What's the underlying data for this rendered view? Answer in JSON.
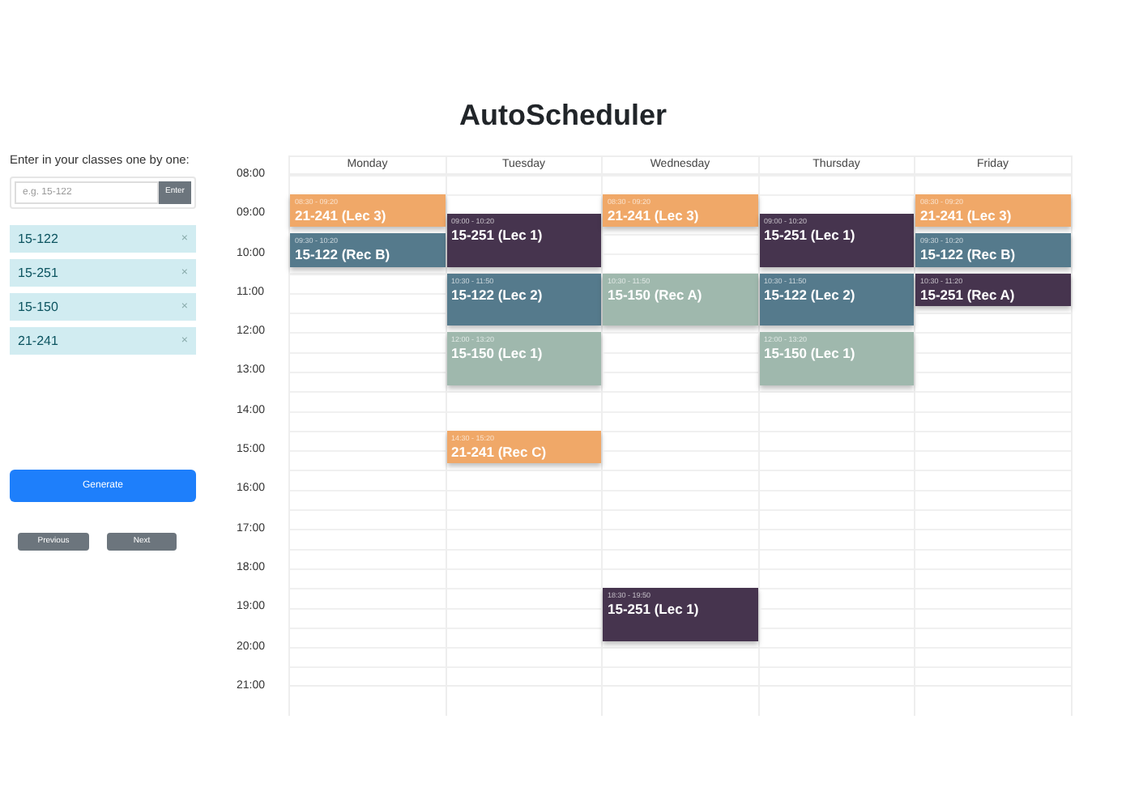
{
  "title": "AutoScheduler",
  "input_panel": {
    "label": "Enter in your classes one by one:",
    "placeholder": "e.g. 15-122",
    "enter_button": "Enter",
    "classes": [
      {
        "name": "15-122",
        "remove": "×"
      },
      {
        "name": "15-251",
        "remove": "×"
      },
      {
        "name": "15-150",
        "remove": "×"
      },
      {
        "name": "21-241",
        "remove": "×"
      }
    ],
    "generate_button": "Generate",
    "previous_button": "Previous",
    "next_button": "Next"
  },
  "calendar": {
    "times": [
      "08:00",
      "09:00",
      "10:00",
      "11:00",
      "12:00",
      "13:00",
      "14:00",
      "15:00",
      "16:00",
      "17:00",
      "18:00",
      "19:00",
      "20:00",
      "21:00"
    ],
    "days": [
      {
        "name": "Monday",
        "events": [
          {
            "time": "08:30 - 09:20",
            "title": "21-241 (Lec 3)",
            "color": "#f0a868"
          },
          {
            "time": "09:30 - 10:20",
            "title": "15-122 (Rec B)",
            "color": "#557a8c"
          }
        ]
      },
      {
        "name": "Tuesday",
        "events": [
          {
            "time": "09:00 - 10:20",
            "title": "15-251 (Lec 1)",
            "color": "#46344e"
          },
          {
            "time": "10:30 - 11:50",
            "title": "15-122 (Lec 2)",
            "color": "#557a8c"
          },
          {
            "time": "12:00 - 13:20",
            "title": "15-150 (Lec 1)",
            "color": "#9fb8ad"
          },
          {
            "time": "14:30 - 15:20",
            "title": "21-241 (Rec C)",
            "color": "#f0a868"
          }
        ]
      },
      {
        "name": "Wednesday",
        "events": [
          {
            "time": "08:30 - 09:20",
            "title": "21-241 (Lec 3)",
            "color": "#f0a868"
          },
          {
            "time": "10:30 - 11:50",
            "title": "15-150 (Rec A)",
            "color": "#9fb8ad"
          },
          {
            "time": "18:30 - 19:50",
            "title": "15-251 (Lec 1)",
            "color": "#46344e"
          }
        ]
      },
      {
        "name": "Thursday",
        "events": [
          {
            "time": "09:00 - 10:20",
            "title": "15-251 (Lec 1)",
            "color": "#46344e"
          },
          {
            "time": "10:30 - 11:50",
            "title": "15-122 (Lec 2)",
            "color": "#557a8c"
          },
          {
            "time": "12:00 - 13:20",
            "title": "15-150 (Lec 1)",
            "color": "#9fb8ad"
          }
        ]
      },
      {
        "name": "Friday",
        "events": [
          {
            "time": "08:30 - 09:20",
            "title": "21-241 (Lec 3)",
            "color": "#f0a868"
          },
          {
            "time": "09:30 - 10:20",
            "title": "15-122 (Rec B)",
            "color": "#557a8c"
          },
          {
            "time": "10:30 - 11:20",
            "title": "15-251 (Rec A)",
            "color": "#46344e"
          }
        ]
      }
    ]
  }
}
